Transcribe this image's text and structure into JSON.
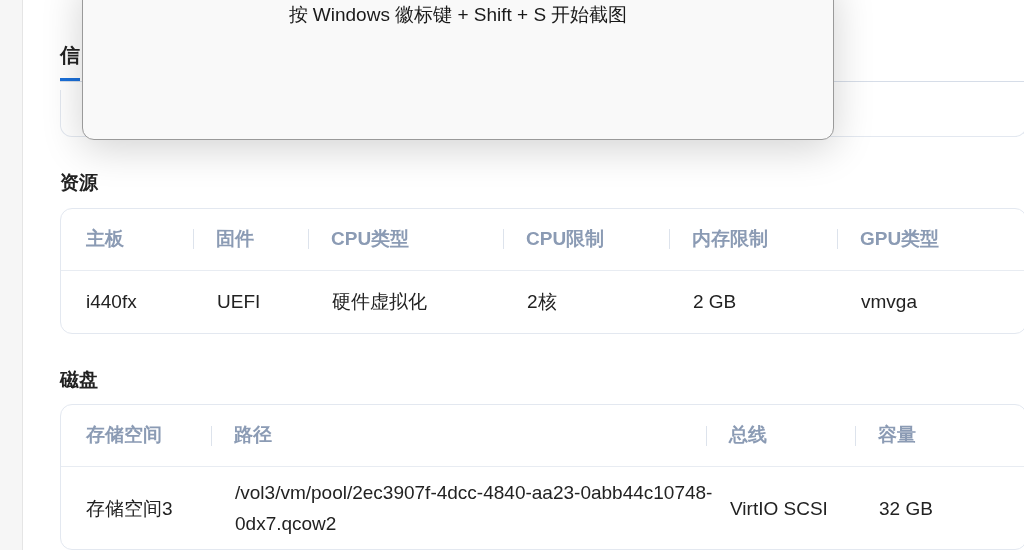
{
  "dialog": {
    "message": "按 Windows 徽标键 + Shift + S 开始截图"
  },
  "tabs": [
    {
      "label": "信",
      "selected": true
    }
  ],
  "resources": {
    "title": "资源",
    "columns": [
      "主板",
      "固件",
      "CPU类型",
      "CPU限制",
      "内存限制",
      "GPU类型"
    ],
    "rows": [
      [
        "i440fx",
        "UEFI",
        "硬件虚拟化",
        "2核",
        "2 GB",
        "vmvga"
      ]
    ]
  },
  "disks": {
    "title": "磁盘",
    "columns": [
      "存储空间",
      "路径",
      "总线",
      "容量"
    ],
    "rows": [
      [
        "存储空间3",
        "/vol3/vm/pool/2ec3907f-4dcc-4840-aa23-0abb44c10748-0dx7.qcow2",
        "VirtIO SCSI",
        "32 GB"
      ]
    ]
  }
}
